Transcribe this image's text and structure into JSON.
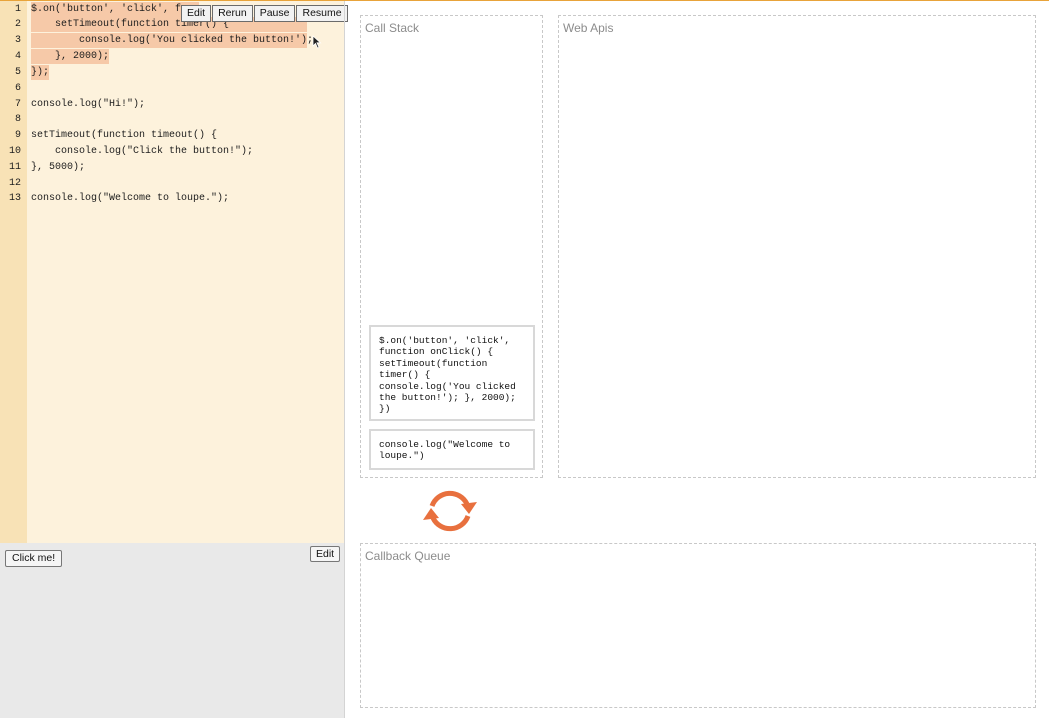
{
  "toolbar": {
    "edit": "Edit",
    "rerun": "Rerun",
    "pause": "Pause",
    "resume": "Resume"
  },
  "code": {
    "lines": [
      {
        "num": "1",
        "text": "$.on('button', 'click', func"
      },
      {
        "num": "2",
        "text": "    setTimeout(function timer() {"
      },
      {
        "num": "3",
        "text": "        console.log('You clicked the button!');"
      },
      {
        "num": "4",
        "text": "    }, 2000);"
      },
      {
        "num": "5",
        "text": "});"
      },
      {
        "num": "6",
        "text": ""
      },
      {
        "num": "7",
        "text": "console.log(\"Hi!\");"
      },
      {
        "num": "8",
        "text": ""
      },
      {
        "num": "9",
        "text": "setTimeout(function timeout() {"
      },
      {
        "num": "10",
        "text": "    console.log(\"Click the button!\");"
      },
      {
        "num": "11",
        "text": "}, 5000);"
      },
      {
        "num": "12",
        "text": ""
      },
      {
        "num": "13",
        "text": "console.log(\"Welcome to loupe.\");"
      }
    ]
  },
  "render": {
    "click_button": "Click me!",
    "edit_button": "Edit"
  },
  "call_stack": {
    "title": "Call Stack",
    "frames": [
      "$.on('button', 'click', function onClick() { setTimeout(function timer() { console.log('You clicked the button!'); }, 2000); })",
      "console.log(\"Welcome to loupe.\")"
    ]
  },
  "web_apis": {
    "title": "Web Apis"
  },
  "callback_queue": {
    "title": "Callback Queue"
  },
  "colors": {
    "accent": "#e8a33a",
    "highlight": "#f6c9a8",
    "loop": "#e8703e"
  }
}
